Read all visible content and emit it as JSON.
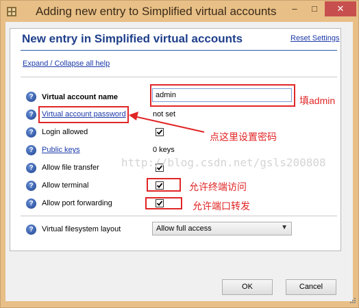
{
  "window": {
    "title": "Adding new entry to Simplified virtual accounts",
    "minimize_glyph": "–",
    "maximize_glyph": "□",
    "close_glyph": "✕"
  },
  "header": {
    "title": "New entry in Simplified virtual accounts",
    "reset_link": "Reset Settings"
  },
  "expand_link": "Expand / Collapse all help",
  "help_glyph": "?",
  "fields": {
    "account_name": {
      "label": "Virtual account name",
      "value": "admin"
    },
    "password": {
      "label": "Virtual account password",
      "value": "not set"
    },
    "login_allowed": {
      "label": "Login allowed",
      "checked": true
    },
    "public_keys": {
      "label": "Public keys",
      "value": "0 keys"
    },
    "allow_file_transfer": {
      "label": "Allow file transfer",
      "checked": true
    },
    "allow_terminal": {
      "label": "Allow terminal",
      "checked": true
    },
    "allow_port_forwarding": {
      "label": "Allow port forwarding",
      "checked": true
    },
    "filesystem_layout": {
      "label": "Virtual filesystem layout",
      "selected": "Allow full access"
    }
  },
  "buttons": {
    "ok": "OK",
    "cancel": "Cancel"
  },
  "annotations": {
    "fill_admin": "填admin",
    "set_password": "点这里设置密码",
    "allow_terminal": "允许终端访问",
    "allow_port_forwarding": "允许端口转发"
  },
  "watermark": "http://blog.csdn.net/gsls200808",
  "colors": {
    "titlebar": "#e8bf86",
    "header_blue": "#1f3f8a",
    "link_blue": "#1a38a8",
    "annotation_red": "#e02525"
  }
}
